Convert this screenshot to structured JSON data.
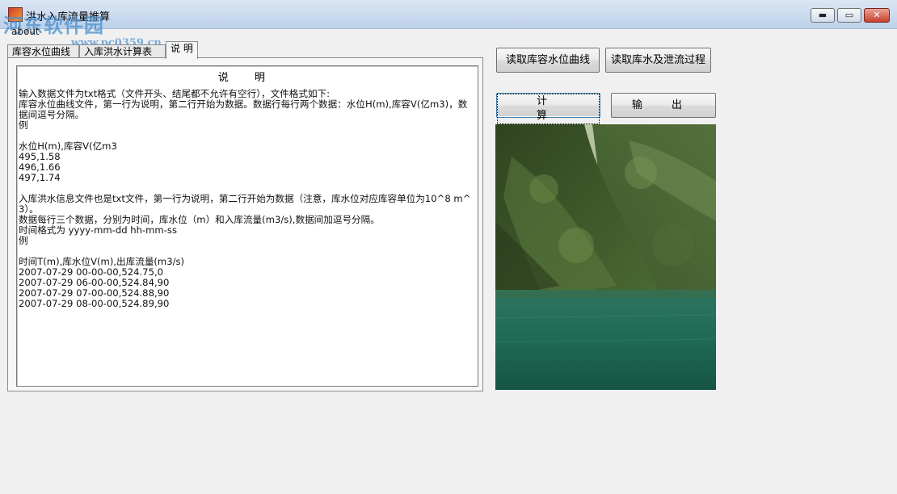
{
  "window": {
    "title": "洪水入库流量推算",
    "watermark": "河东软件园",
    "watermark_url": "www.pc0359.cn",
    "menu_about": "about",
    "min_glyph": "▬",
    "max_glyph": "▭",
    "close_glyph": "✕"
  },
  "tabs": [
    {
      "label": "库容水位曲线",
      "active": false
    },
    {
      "label": "入库洪水计算表",
      "active": false
    },
    {
      "label": "说 明",
      "active": true
    }
  ],
  "doc": {
    "heading": "说 明",
    "lines": [
      "输入数据文件为txt格式（文件开头、结尾都不允许有空行），文件格式如下:",
      "库容水位曲线文件，第一行为说明，第二行开始为数据。数据行每行两个数据：水位H(m),库容V(亿m3)，数据间逗号分隔。",
      "例",
      "",
      "水位H(m),库容V(亿m3",
      "495,1.58",
      "496,1.66",
      "497,1.74",
      "",
      "入库洪水信息文件也是txt文件，第一行为说明，第二行开始为数据（注意，库水位对应库容单位为10^8 m^3）。",
      "数据每行三个数据，分别为时间，库水位（m）和入库流量(m3/s),数据间加逗号分隔。",
      "时间格式为 yyyy-mm-dd hh-mm-ss",
      "例",
      "",
      "时间T(m),库水位V(m),出库流量(m3/s)",
      "2007-07-29 00-00-00,524.75,0",
      "2007-07-29 06-00-00,524.84,90",
      "2007-07-29 07-00-00,524.88,90",
      "2007-07-29 08-00-00,524.89,90"
    ]
  },
  "buttons": {
    "read_curve": "读取库容水位曲线",
    "read_process": "读取库水及泄流过程",
    "calc": "计 算",
    "output": "输 出"
  },
  "icons": {
    "app": "flood-app-icon",
    "minimize": "minimize-icon",
    "maximize": "maximize-icon",
    "close": "close-icon"
  },
  "colors": {
    "close_button": "#c8402e",
    "focus_border": "#3c7fb1",
    "water": "#1f6a55",
    "forest": "#3d5a2a"
  }
}
